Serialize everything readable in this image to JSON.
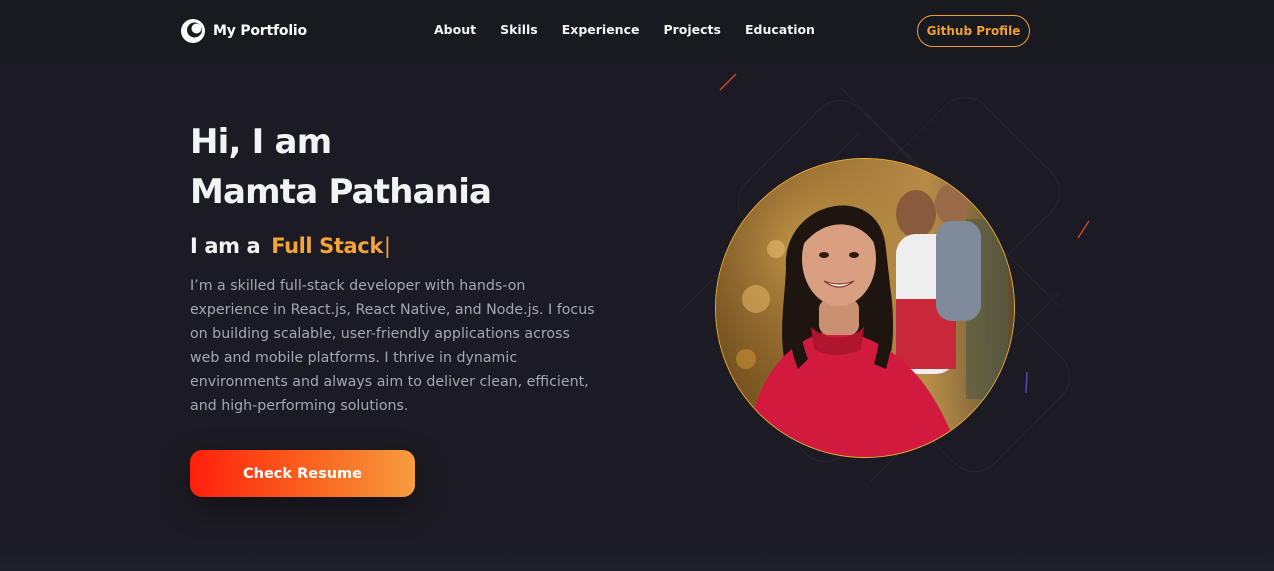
{
  "navbar": {
    "logo_text": "My Portfolio",
    "links": [
      "About",
      "Skills",
      "Experience",
      "Projects",
      "Education"
    ],
    "github_label": "Github Profile"
  },
  "hero": {
    "greeting": "Hi, I am",
    "name": "Mamta Pathania",
    "role_prefix": "I am a",
    "role_typed": "Full Stack",
    "role_caret": "|",
    "description": "I’m a skilled full-stack developer with hands-on experience in React.js, React Native, and Node.js. I focus on building scalable, user-friendly applications across web and mobile platforms. I thrive in dynamic environments and always aim to deliver clean, efficient, and high-performing solutions.",
    "resume_label": "Check Resume"
  },
  "colors": {
    "background": "#1c1b23",
    "navbar": "#191920",
    "accent": "#f4a33a",
    "text_primary": "#f2f3f4",
    "text_secondary": "#a3a7b5",
    "button_gradient_start": "#ff1f0c",
    "button_gradient_end": "#f79c3e"
  },
  "icons": {
    "logo": "portfolio-logo-icon",
    "photo": "profile-photo"
  }
}
